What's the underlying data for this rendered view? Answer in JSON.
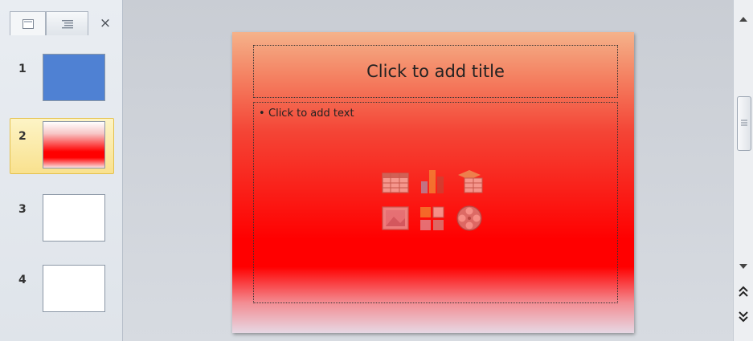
{
  "slides_pane": {
    "tabs": [
      {
        "name": "slides-tab-icon"
      },
      {
        "name": "outline-tab-icon"
      }
    ],
    "close_label": "×",
    "thumbnails": [
      {
        "number": "1",
        "fill": "#4f81d3"
      },
      {
        "number": "2",
        "fill": "gradient-red"
      },
      {
        "number": "3",
        "fill": "#ffffff"
      },
      {
        "number": "4",
        "fill": "#ffffff"
      }
    ],
    "selected_index": 1
  },
  "slide": {
    "title_placeholder": "Click to add title",
    "content_placeholder": "Click to add text",
    "bullet": "•",
    "insert_icons": [
      "insert-table-icon",
      "insert-chart-icon",
      "insert-smartart-icon",
      "insert-picture-icon",
      "insert-clip-art-icon",
      "insert-media-icon"
    ]
  },
  "colors": {
    "slide_gradient_top": "#f5b28a",
    "slide_gradient_mid": "#ff0000",
    "slide_gradient_bottom": "#e7d8e4",
    "selection_highlight": "#f9e18e",
    "thumb1_blue": "#4f81d3"
  }
}
